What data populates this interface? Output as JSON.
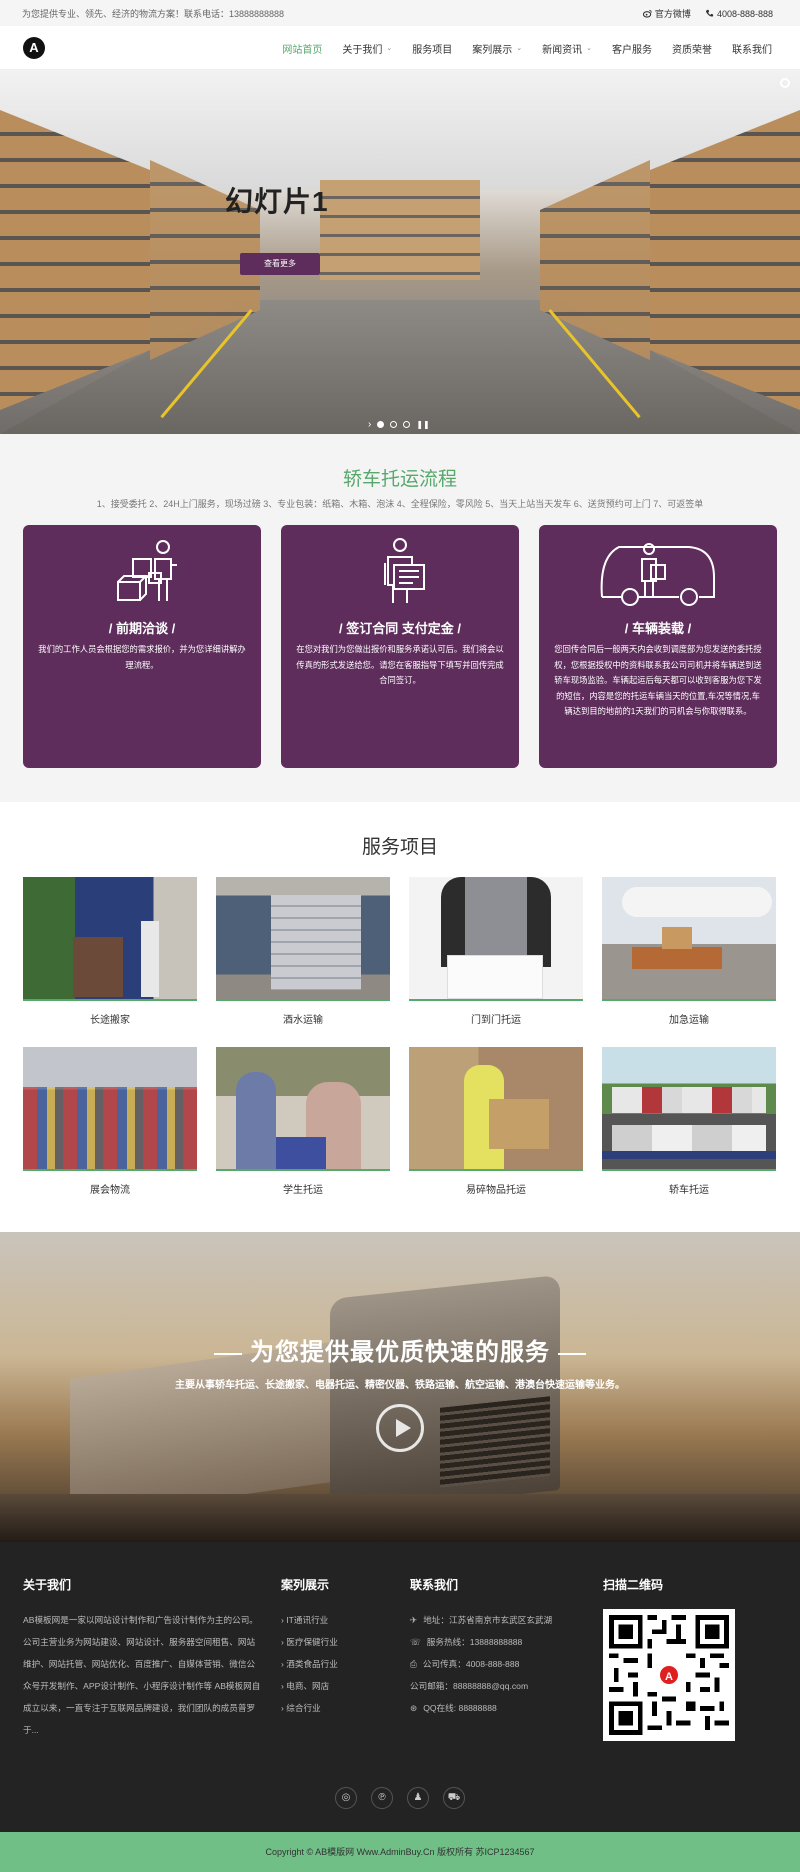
{
  "topbar": {
    "slogan": "为您提供专业、领先、经济的物流方案！联系电话：13888888888",
    "weibo_label": "官方微博",
    "phone": "4008-888-888"
  },
  "header": {
    "logo_text": "A",
    "nav": [
      {
        "label": "网站首页",
        "active": true,
        "dropdown": false
      },
      {
        "label": "关于我们",
        "active": false,
        "dropdown": true
      },
      {
        "label": "服务项目",
        "active": false,
        "dropdown": false
      },
      {
        "label": "案列展示",
        "active": false,
        "dropdown": true
      },
      {
        "label": "新闻资讯",
        "active": false,
        "dropdown": true
      },
      {
        "label": "客户服务",
        "active": false,
        "dropdown": false
      },
      {
        "label": "资质荣誉",
        "active": false,
        "dropdown": false
      },
      {
        "label": "联系我们",
        "active": false,
        "dropdown": false
      }
    ]
  },
  "hero": {
    "title": "幻灯片1",
    "button_label": "查看更多",
    "slides": 3,
    "active_slide": 1
  },
  "process": {
    "title": "轿车托运流程",
    "subtitle": "1、接受委托 2、24H上门服务，现场过磅 3、专业包装：纸箱、木箱、泡沫 4、全程保险，零风险 5、当天上站当天发车 6、送货预约可上门 7、可返签单",
    "cards": [
      {
        "title": "/  前期洽谈  /",
        "text": "我们的工作人员会根据您的需求报价，并为您详细讲解办理流程。",
        "icon": "boxes-person-icon"
      },
      {
        "title": "/  签订合同 支付定金  /",
        "text": "在您对我们为您做出报价和服务承诺认可后。我们将会以传真的形式发送给您。请您在客服指导下填写并回传完成合同签订。",
        "icon": "person-contract-icon"
      },
      {
        "title": "/  车辆装载  /",
        "text": "您回传合同后一般两天内会收到调度部为您发送的委托授权，您根据授权中的资料联系我公司司机并将车辆送到送轿车现场监验。车辆起运后每天都可以收到客服为您下发的短信，内容是您的托运车辆当天的位置,车况等情况,车辆达到目的地前的1天我们的司机会与你取得联系。",
        "icon": "truck-loading-icon"
      }
    ]
  },
  "services": {
    "title": "服务项目",
    "items": [
      {
        "label": "长途搬家"
      },
      {
        "label": "酒水运输"
      },
      {
        "label": "门到门托运"
      },
      {
        "label": "加急运输"
      },
      {
        "label": "展会物流"
      },
      {
        "label": "学生托运"
      },
      {
        "label": "易碎物品托运"
      },
      {
        "label": "轿车托运"
      }
    ]
  },
  "banner": {
    "title": "为您提供最优质快速的服务",
    "subtitle": "主要从事轿车托运、长途搬家、电器托运、精密仪器、铁路运输、航空运输、港澳台快速运输等业务。"
  },
  "footer": {
    "about": {
      "title": "关于我们",
      "text": "AB模板网是一家以网站设计制作和广告设计制作为主的公司。公司主营业务为网站建设、网站设计、服务器空间租售、网站维护、网站托管、网站优化、百度推广、自媒体营销、微信公众号开发制作、APP设计制作、小程序设计制作等 AB模板网自成立以来，一直专注于互联网品牌建设，我们团队的成员普罗于..."
    },
    "cases": {
      "title": "案列展示",
      "items": [
        "IT通讯行业",
        "医疗保健行业",
        "酒类食品行业",
        "电商、网店",
        "综合行业"
      ]
    },
    "contact": {
      "title": "联系我们",
      "address": "地址：江苏省南京市玄武区玄武湖",
      "hotline": "服务热线：13888888888",
      "fax": "公司传真：4008-888-888",
      "email": "公司邮箱：88888888@qq.com",
      "qq": "QQ在线: 88888888"
    },
    "qr": {
      "title": "扫描二维码",
      "logo_text": "A"
    },
    "copyright": "Copyright © AB模版网 Www.AdminBuy.Cn 版权所有    苏ICP1234567"
  }
}
